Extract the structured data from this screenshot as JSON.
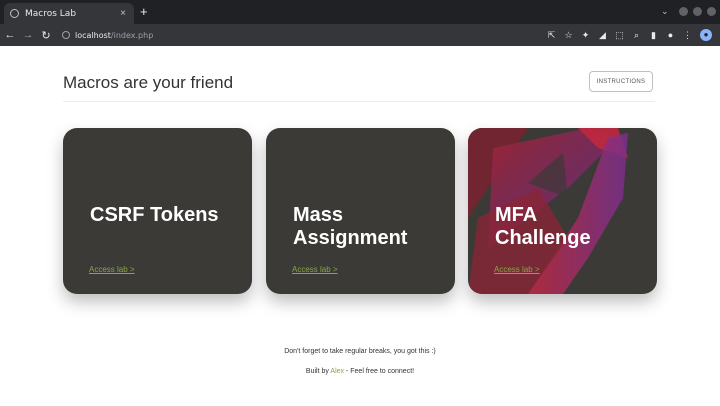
{
  "browser": {
    "tab_title": "Macros Lab",
    "tab_close": "×",
    "new_tab": "+",
    "url_host": "localhost",
    "url_path": "/index.php"
  },
  "page": {
    "heading": "Macros are your friend",
    "instructions_label": "INSTRUCTIONS",
    "cards": [
      {
        "title_line1": "CSRF Tokens",
        "title_line2": "",
        "link": "Access lab >"
      },
      {
        "title_line1": "Mass",
        "title_line2": "Assignment",
        "link": "Access lab >"
      },
      {
        "title_line1": "MFA",
        "title_line2": "Challenge",
        "link": "Access lab >"
      }
    ],
    "footer_line1": "Don't forget to take regular breaks, you got this :)",
    "footer_prefix": "Built by ",
    "footer_author": "Alex",
    "footer_suffix": " - Feel free to connect!"
  },
  "colors": {
    "card_bg": "#3b3a36",
    "link": "#8aa44a",
    "card_art_red": "#b0283a",
    "card_art_purple": "#6a3a9a"
  }
}
